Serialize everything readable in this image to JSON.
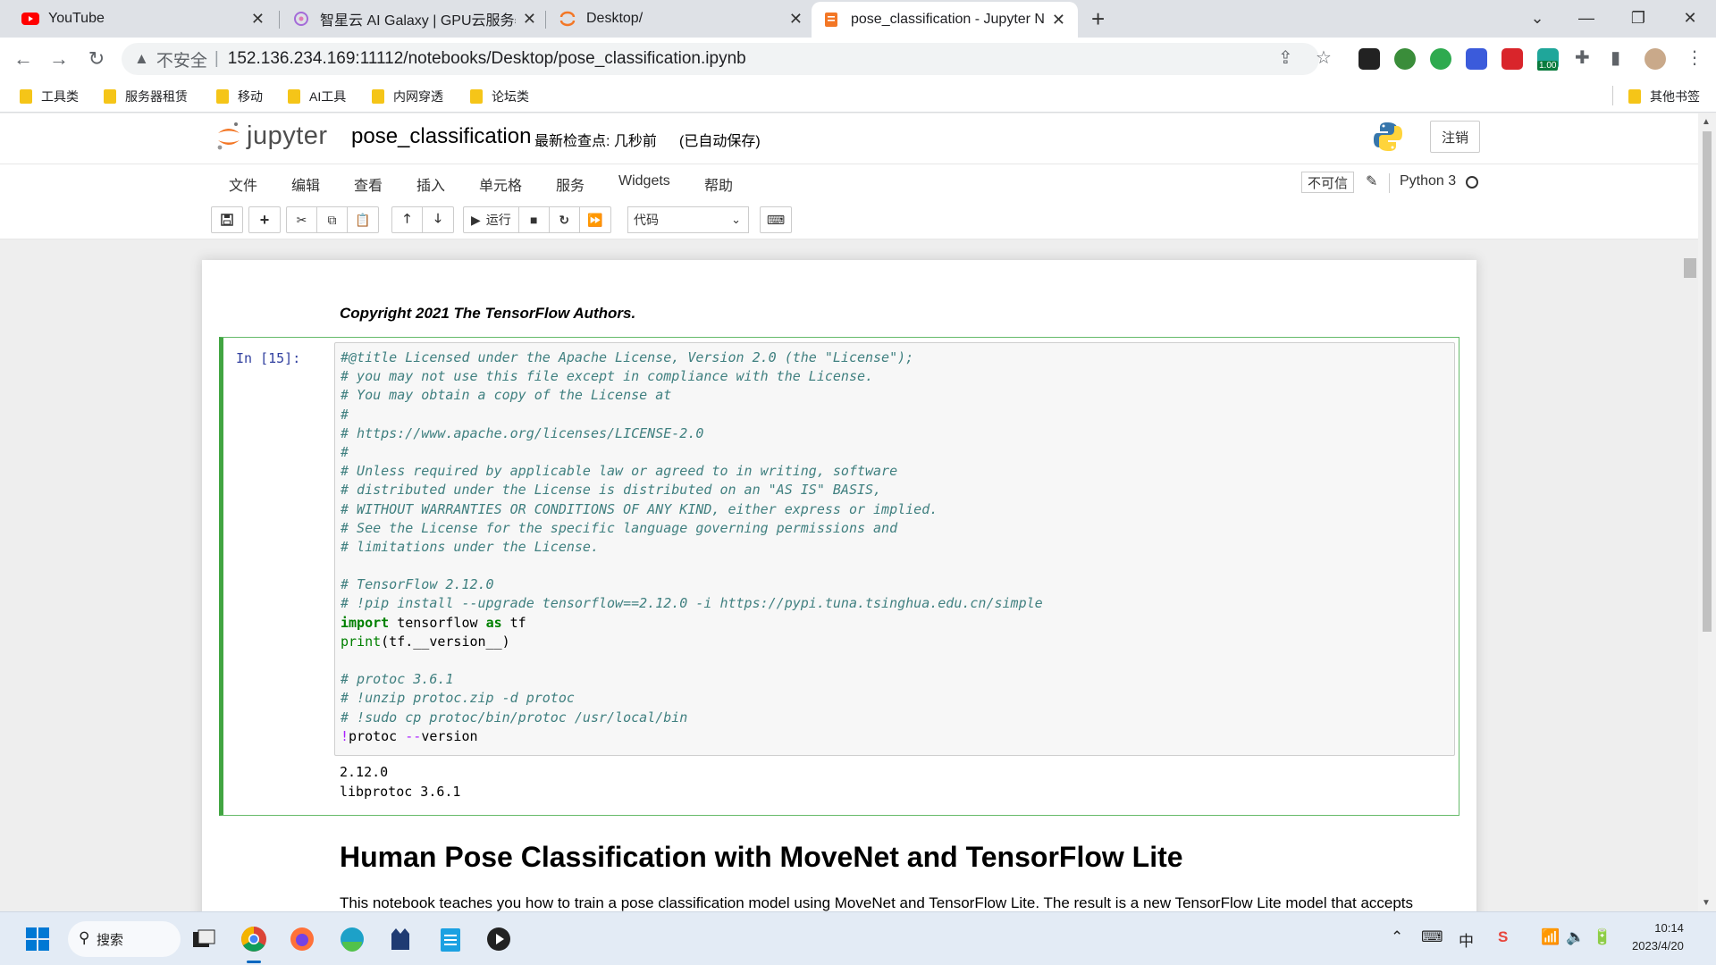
{
  "browser": {
    "tabs": [
      {
        "title": "YouTube",
        "icon": "youtube-icon",
        "active": false
      },
      {
        "title": "智星云 AI Galaxy | GPU云服务器",
        "icon": "galaxy-icon",
        "active": false
      },
      {
        "title": "Desktop/",
        "icon": "jupyter-icon",
        "active": false
      },
      {
        "title": "pose_classification - Jupyter N",
        "icon": "notebook-icon",
        "active": true
      }
    ],
    "address": {
      "insecure_label": "不安全",
      "url": "152.136.234.169:11112/notebooks/Desktop/pose_classification.ipynb"
    },
    "extension_badge": "1.00",
    "bookmarks": [
      "工具类",
      "服务器租赁",
      "移动",
      "AI工具",
      "内网穿透",
      "论坛类"
    ],
    "other_bookmarks": "其他书签"
  },
  "jupyter": {
    "logo_text": "jupyter",
    "notebook_name": "pose_classification",
    "checkpoint": "最新检查点: 几秒前",
    "autosave": "(已自动保存)",
    "logout_label": "注销",
    "menu": [
      "文件",
      "编辑",
      "查看",
      "插入",
      "单元格",
      "服务",
      "Widgets",
      "帮助"
    ],
    "trusted_label": "不可信",
    "kernel_name": "Python 3",
    "toolbar": {
      "run_label": "运行",
      "cell_type": "代码"
    }
  },
  "notebook": {
    "copyright": "Copyright 2021 The TensorFlow Authors.",
    "cell": {
      "prompt": "In  [15]:",
      "code_lines": [
        {
          "type": "comment",
          "text": "#@title Licensed under the Apache License, Version 2.0 (the \"License\");"
        },
        {
          "type": "comment",
          "text": "# you may not use this file except in compliance with the License."
        },
        {
          "type": "comment",
          "text": "# You may obtain a copy of the License at"
        },
        {
          "type": "comment",
          "text": "#"
        },
        {
          "type": "comment",
          "text": "# https://www.apache.org/licenses/LICENSE-2.0"
        },
        {
          "type": "comment",
          "text": "#"
        },
        {
          "type": "comment",
          "text": "# Unless required by applicable law or agreed to in writing, software"
        },
        {
          "type": "comment",
          "text": "# distributed under the License is distributed on an \"AS IS\" BASIS,"
        },
        {
          "type": "comment",
          "text": "# WITHOUT WARRANTIES OR CONDITIONS OF ANY KIND, either express or implied."
        },
        {
          "type": "comment",
          "text": "# See the License for the specific language governing permissions and"
        },
        {
          "type": "comment",
          "text": "# limitations under the License."
        },
        {
          "type": "blank",
          "text": ""
        },
        {
          "type": "comment",
          "text": "# TensorFlow 2.12.0"
        },
        {
          "type": "comment",
          "text": "# !pip install --upgrade tensorflow==2.12.0 -i https://pypi.tuna.tsinghua.edu.cn/simple"
        },
        {
          "type": "import",
          "kw1": "import",
          "mid": " tensorflow ",
          "kw2": "as",
          "end": " tf"
        },
        {
          "type": "print",
          "fn": "print",
          "rest": "(tf.__version__)"
        },
        {
          "type": "blank",
          "text": ""
        },
        {
          "type": "comment",
          "text": "# protoc 3.6.1"
        },
        {
          "type": "comment",
          "text": "# !unzip protoc.zip -d protoc"
        },
        {
          "type": "comment",
          "text": "# !sudo cp protoc/bin/protoc /usr/local/bin"
        },
        {
          "type": "shell",
          "bang": "!",
          "a": "protoc ",
          "op": "--",
          "b": "version"
        }
      ],
      "output": [
        "2.12.0",
        "libprotoc 3.6.1"
      ]
    },
    "heading": "Human Pose Classification with MoveNet and TensorFlow Lite",
    "paragraph": "This notebook teaches you how to train a pose classification model using MoveNet and TensorFlow Lite. The result is a new TensorFlow Lite model that accepts"
  },
  "taskbar": {
    "search_label": "搜索",
    "ime": "中",
    "time": "10:14",
    "date": "2023/4/20"
  }
}
